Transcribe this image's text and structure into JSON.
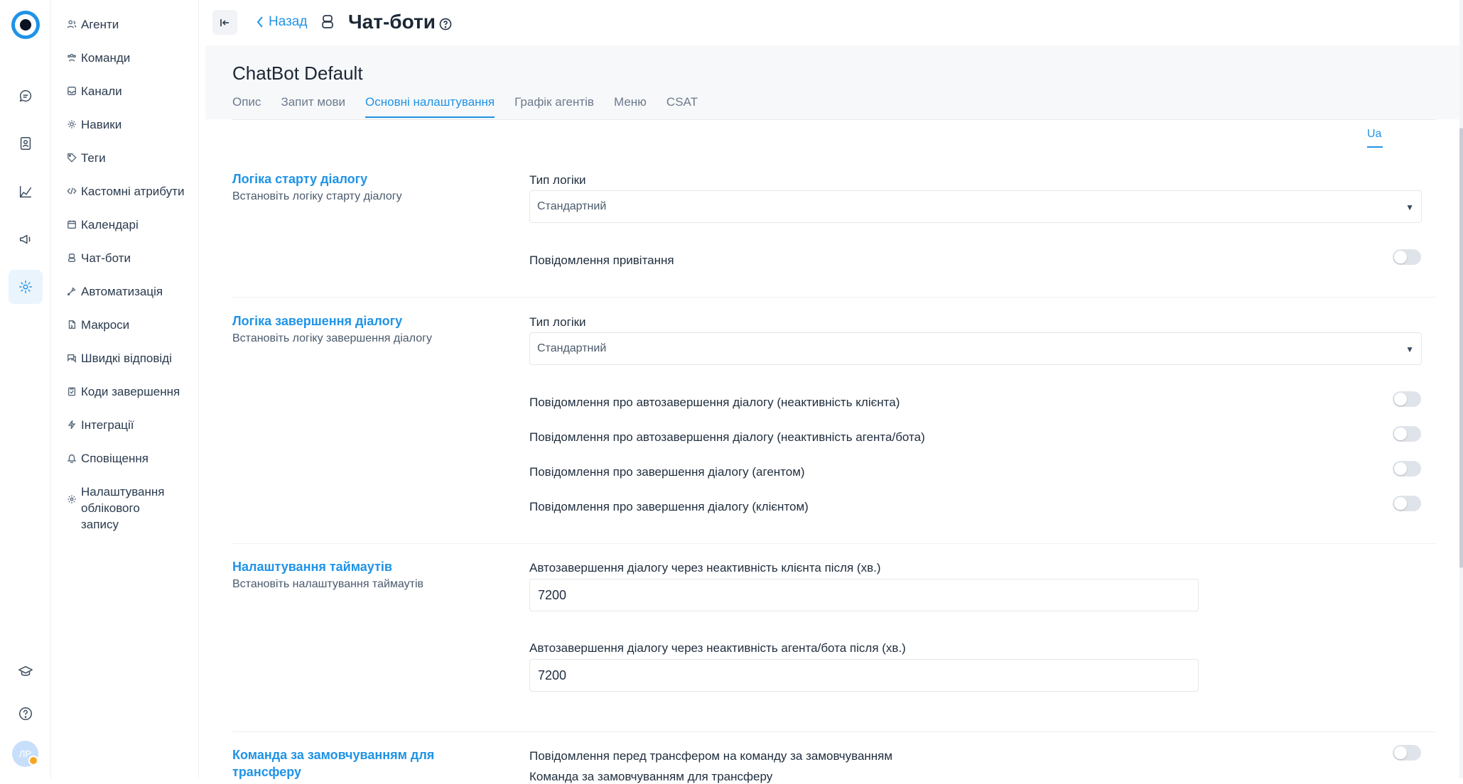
{
  "rail": {
    "icons": [
      "logo-icon",
      "chat-icon",
      "contacts-icon",
      "reports-icon",
      "campaigns-icon",
      "settings-icon",
      "academy-icon",
      "help-icon"
    ],
    "avatar_initials": "ЛР",
    "status_color": "#f5a623"
  },
  "menu": {
    "items": [
      {
        "label": "Агенти",
        "icon": "agents-icon"
      },
      {
        "label": "Команди",
        "icon": "teams-icon"
      },
      {
        "label": "Канали",
        "icon": "inbox-icon"
      },
      {
        "label": "Навики",
        "icon": "skills-icon"
      },
      {
        "label": "Теги",
        "icon": "tag-icon"
      },
      {
        "label": "Кастомні атрибути",
        "icon": "code-icon"
      },
      {
        "label": "Календарі",
        "icon": "calendar-icon"
      },
      {
        "label": "Чат-боти",
        "icon": "bot-icon"
      },
      {
        "label": "Автоматизація",
        "icon": "automation-icon"
      },
      {
        "label": "Макроси",
        "icon": "macros-icon"
      },
      {
        "label": "Швидкі відповіді",
        "icon": "canned-responses-icon"
      },
      {
        "label": "Коди завершення",
        "icon": "clipboard-icon"
      },
      {
        "label": "Інтеграції",
        "icon": "flash-icon"
      },
      {
        "label": "Сповіщення",
        "icon": "bell-icon"
      },
      {
        "label": "Налаштування облікового запису",
        "icon": "gear-icon"
      }
    ]
  },
  "header": {
    "back_label": "Назад",
    "title": "Чат-боти"
  },
  "bot": {
    "name": "ChatBot Default",
    "tabs": [
      "Опис",
      "Запит мови",
      "Основні налаштування",
      "Графік агентів",
      "Меню",
      "CSAT"
    ],
    "active_tab": "Основні налаштування",
    "language": "Ua"
  },
  "sections": {
    "start": {
      "title": "Логіка старту діалогу",
      "description": "Встановіть логіку старту діалогу",
      "logic_label": "Тип логіки",
      "logic_value": "Стандартний",
      "greeting_label": "Повідомлення привітання"
    },
    "end": {
      "title": "Логіка завершення діалогу",
      "description": "Встановіть логіку завершення діалогу",
      "logic_label": "Тип логіки",
      "logic_value": "Стандартний",
      "toggles": [
        "Повідомлення про автозавершення діалогу (неактивність клієнта)",
        "Повідомлення про автозавершення діалогу (неактивність агента/бота)",
        "Повідомлення про завершення діалогу (агентом)",
        "Повідомлення про завершення діалогу (клієнтом)"
      ]
    },
    "timeouts": {
      "title": "Налаштування таймаутів",
      "description": "Встановіть налаштування таймаутів",
      "client_label": "Автозавершення діалогу через неактивність клієнта після (хв.)",
      "client_value": "7200",
      "agent_label": "Автозавершення діалогу через неактивність агента/бота після (хв.)",
      "agent_value": "7200"
    },
    "transfer": {
      "title": "Команда за замовчуванням для трансферу",
      "toggle_label": "Повідомлення перед трансфером на команду за замовчуванням",
      "team_label": "Команда за замовчуванням для трансферу"
    }
  },
  "colors": {
    "accent": "#1f93e6",
    "toggle_off": "#dfe4ea"
  }
}
